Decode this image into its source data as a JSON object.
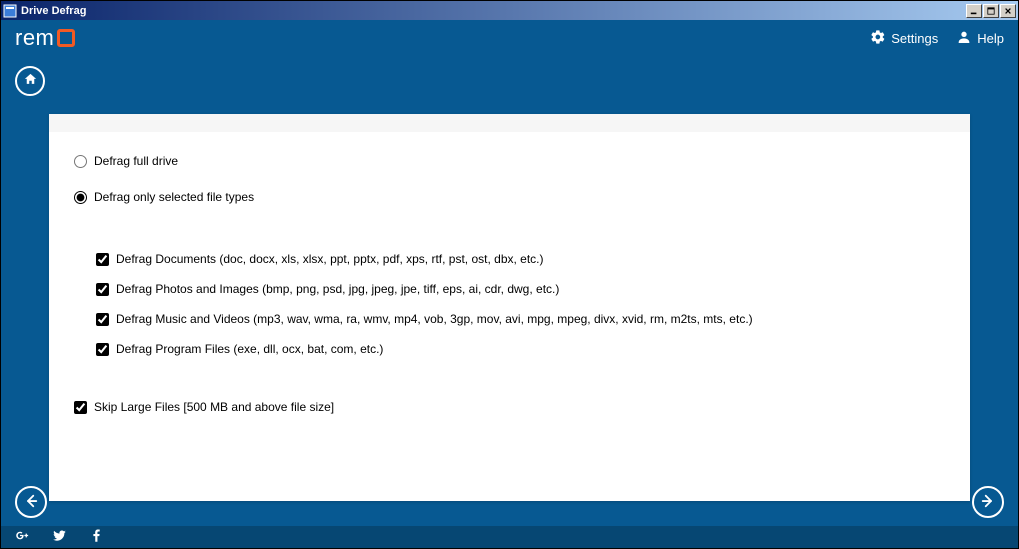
{
  "window": {
    "title": "Drive Defrag"
  },
  "brand": {
    "text": "rem"
  },
  "header": {
    "settings": "Settings",
    "help": "Help"
  },
  "options": {
    "full_drive": "Defrag full drive",
    "selected_types": "Defrag only selected file types",
    "documents": "Defrag Documents (doc, docx, xls, xlsx, ppt, pptx, pdf, xps, rtf, pst, ost, dbx, etc.)",
    "photos": "Defrag Photos and Images (bmp, png, psd, jpg, jpeg, jpe, tiff, eps, ai, cdr, dwg, etc.)",
    "music": "Defrag Music and Videos (mp3, wav, wma, ra, wmv, mp4, vob, 3gp, mov, avi, mpg, mpeg, divx, xvid, rm, m2ts, mts, etc.)",
    "programs": "Defrag Program Files (exe, dll, ocx, bat, com, etc.)",
    "skip_large": "Skip Large Files [500 MB and above file size]"
  }
}
